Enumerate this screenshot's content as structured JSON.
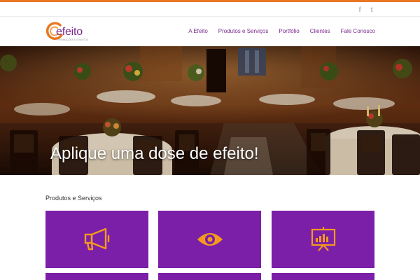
{
  "colors": {
    "accent": "#e87722",
    "brand_purple": "#7c1fa8",
    "nav_text": "#7a2a8c"
  },
  "topbar": {
    "social": [
      {
        "name": "facebook-icon",
        "glyph": "f"
      },
      {
        "name": "twitter-icon",
        "glyph": "t"
      }
    ]
  },
  "logo": {
    "text": "efeito",
    "tagline": "PROMOÇÕES E EVENTOS"
  },
  "nav": {
    "items": [
      "A Efeito",
      "Produtos e Serviços",
      "Portfólio",
      "Clientes",
      "Fale Conosco"
    ]
  },
  "hero": {
    "title": "Aplique uma dose de efeito!"
  },
  "products": {
    "title": "Produtos e Serviços",
    "tiles": [
      {
        "icon": "megaphone-icon"
      },
      {
        "icon": "eye-icon"
      },
      {
        "icon": "presentation-board-icon"
      }
    ]
  }
}
